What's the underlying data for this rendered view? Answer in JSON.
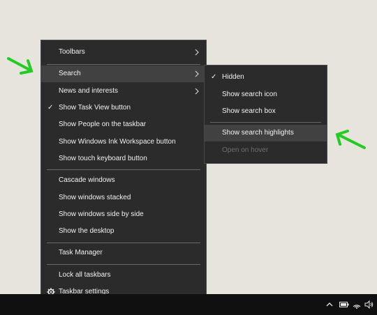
{
  "menu": {
    "items": [
      {
        "label": "Toolbars"
      },
      {
        "label": "Search"
      },
      {
        "label": "News and interests"
      },
      {
        "label": "Show Task View button"
      },
      {
        "label": "Show People on the taskbar"
      },
      {
        "label": "Show Windows Ink Workspace button"
      },
      {
        "label": "Show touch keyboard button"
      },
      {
        "label": "Cascade windows"
      },
      {
        "label": "Show windows stacked"
      },
      {
        "label": "Show windows side by side"
      },
      {
        "label": "Show the desktop"
      },
      {
        "label": "Task Manager"
      },
      {
        "label": "Lock all taskbars"
      },
      {
        "label": "Taskbar settings"
      }
    ]
  },
  "submenu": {
    "items": [
      {
        "label": "Hidden"
      },
      {
        "label": "Show search icon"
      },
      {
        "label": "Show search box"
      },
      {
        "label": "Show search highlights"
      },
      {
        "label": "Open on hover"
      }
    ]
  },
  "icons": {
    "check": "checkmark-icon",
    "chevron": "chevron-right-icon",
    "gear": "gear-icon",
    "tray_up": "chevron-up-icon",
    "battery": "battery-icon",
    "wifi": "wifi-icon",
    "volume": "volume-icon"
  },
  "colors": {
    "menu_bg": "#2b2b2b",
    "hover_bg": "#414141",
    "taskbar": "#101010",
    "annotation_arrow": "#22cc22"
  }
}
